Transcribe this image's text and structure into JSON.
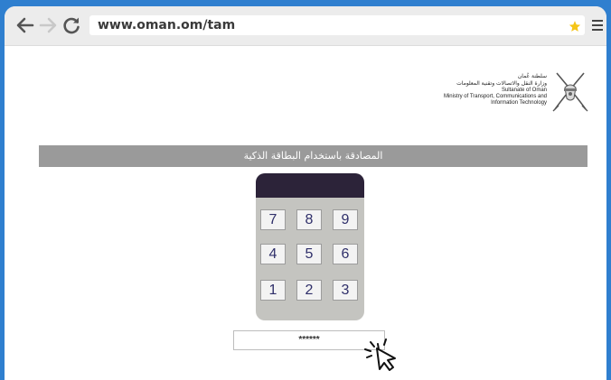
{
  "browser": {
    "url": "www.oman.om/tam",
    "back_icon": "arrow-left-icon",
    "forward_icon": "arrow-right-icon",
    "reload_icon": "reload-icon",
    "bookmark_icon": "star-icon",
    "menu_icon": "hamburger-menu-icon",
    "star_color": "#f5c518"
  },
  "header": {
    "emblem_icon": "oman-emblem-icon",
    "ministry_ar_line1": "سلطنة عُمان",
    "ministry_ar_line2": "وزارة النقل والاتصالات وتقنية المعلومات",
    "ministry_en_line1": "Sultanate of Oman",
    "ministry_en_line2": "Ministry of Transport, Communications and",
    "ministry_en_line3": "Information Technology"
  },
  "auth": {
    "title": "المصادقة باستخدام البطاقة الذكية",
    "banner_color": "#9a9a9a"
  },
  "keypad": {
    "screen_color": "#2c2339",
    "keys": [
      "7",
      "8",
      "9",
      "4",
      "5",
      "6",
      "1",
      "2",
      "3"
    ]
  },
  "pin": {
    "value": "******"
  },
  "pointer": {
    "icon": "click-cursor-icon"
  }
}
